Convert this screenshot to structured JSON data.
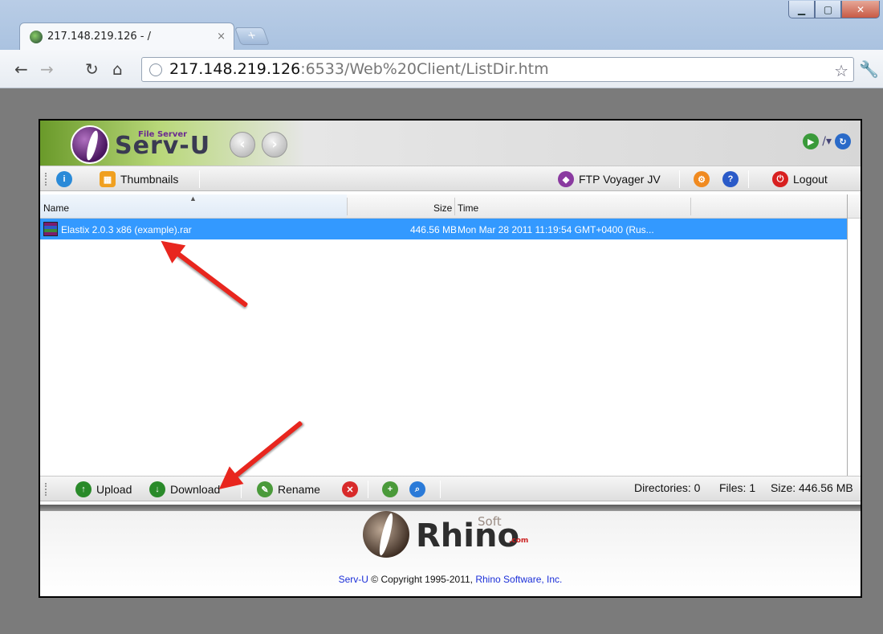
{
  "browser": {
    "tab_title": "217.148.219.126 - /",
    "tab_close": "×",
    "url_host": "217.148.219.126",
    "url_rest": ":6533/Web%20Client/ListDir.htm",
    "window_controls": [
      "minimize",
      "maximize",
      "close"
    ]
  },
  "app": {
    "brand_small": "File Server",
    "brand_name": "Serv-U",
    "top_toolbar": {
      "thumbnails_label": "Thumbnails",
      "ftp_voyager_label": "FTP Voyager JV",
      "logout_label": "Logout"
    },
    "columns": {
      "name": "Name",
      "size": "Size",
      "time": "Time"
    },
    "files": [
      {
        "name": "Elastix 2.0.3 x86 (example).rar",
        "size": "446.56 MB",
        "time": "Mon Mar 28 2011 11:19:54 GMT+0400 (Rus..."
      }
    ],
    "bottom_toolbar": {
      "upload_label": "Upload",
      "download_label": "Download",
      "rename_label": "Rename",
      "status_directories": "Directories: 0",
      "status_files": "Files: 1",
      "status_size": "Size: 446.56 MB"
    },
    "footer": {
      "logo_soft": "Soft",
      "logo_rhino": "Rhino",
      "logo_com": ".com",
      "copy_link1": "Serv-U",
      "copy_text": " © Copyright 1995-2011, ",
      "copy_link2": "Rhino Software, Inc."
    }
  },
  "colors": {
    "selection": "#3399ff",
    "arrow": "#e8261e",
    "page_bg": "#7b7b7b"
  }
}
